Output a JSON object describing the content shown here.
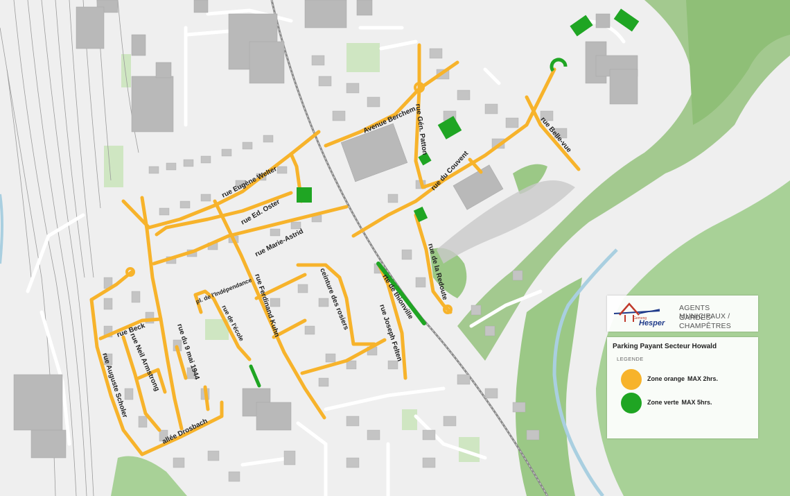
{
  "map": {
    "colors": {
      "orange_zone": "#f7b32b",
      "green_zone": "#1fa523",
      "terrain_green": "#8fc07a",
      "river": "#a9cfe0",
      "building": "#b4b4b4",
      "road": "#ffffff",
      "rail": "#8a8a8a"
    },
    "streets": {
      "rue_eugene_welter": "rue Eugène Welter",
      "avenue_berchem": "Avenue Berchem",
      "rue_gen_patton": "rue Gén. Patton",
      "rue_du_couvent": "rue du Couvent",
      "rue_belle_vue": "rue Belle-vue",
      "rue_ed_oster": "rue Ed. Oster",
      "rue_marie_astrid": "rue Marie-Astrid",
      "rue_de_la_redoute": "rue de la Redoute",
      "rte_de_thionville": "rte de thionville",
      "ceinture_des_rosiers": "ceinture des rosiers",
      "pl_de_lindependance": "pl. de l'Indépendance",
      "rue_ferdinand_kuhn": "rue Ferdinand Kuhn",
      "rue_de_lecole": "rue de l'école",
      "rue_joseph_felten": "rue Joseph Felten",
      "rue_beck": "rue Beck",
      "rue_neil_armstrong": "rue Neil Armstrong",
      "rue_du_9_mai_1944": "rue du 9 mai 1944",
      "rue_auguste_scholer": "rue Auguste Scholer",
      "allee_drosbach": "allée Drosbach"
    }
  },
  "logo": {
    "commune_small": "Gemeng",
    "commune_name": "Hesper",
    "org_line1": "AGENTS MUNICIPAUX /",
    "org_line2": "GARDES-CHAMPÊTRES"
  },
  "legend": {
    "title": "Parking Payant Secteur Howald",
    "heading": "LEGENDE",
    "items": [
      {
        "zone": "Zone orange",
        "duration": "MAX 2hrs.",
        "color": "#f7b32b"
      },
      {
        "zone": "Zone verte",
        "duration": "MAX 5hrs.",
        "color": "#1fa523"
      }
    ]
  }
}
